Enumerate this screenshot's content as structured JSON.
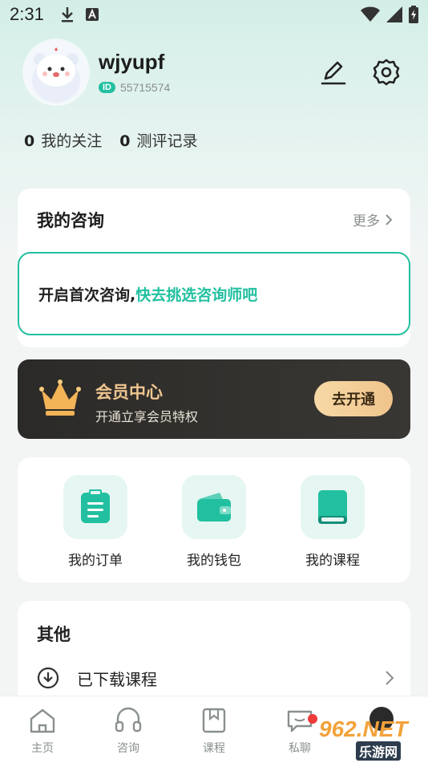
{
  "status_bar": {
    "time": "2:31"
  },
  "profile": {
    "username": "wjyupf",
    "id_badge": "ID",
    "user_id": "55715574"
  },
  "stats": [
    {
      "count": "0",
      "label": "我的关注"
    },
    {
      "count": "0",
      "label": "测评记录"
    }
  ],
  "consult": {
    "title": "我的咨询",
    "more": "更多",
    "prompt_plain": "开启首次咨询,",
    "prompt_link": "快去挑选咨询师吧"
  },
  "vip": {
    "title": "会员中心",
    "subtitle": "开通立享会员特权",
    "button": "去开通"
  },
  "quick_links": [
    {
      "label": "我的订单",
      "icon": "clipboard-icon"
    },
    {
      "label": "我的钱包",
      "icon": "wallet-icon"
    },
    {
      "label": "我的课程",
      "icon": "book-icon"
    }
  ],
  "other": {
    "title": "其他",
    "row_label": "已下载课程"
  },
  "tabs": [
    {
      "label": "主页",
      "icon": "home-icon"
    },
    {
      "label": "咨询",
      "icon": "headset-icon"
    },
    {
      "label": "课程",
      "icon": "bookmark-icon"
    },
    {
      "label": "私聊",
      "icon": "chat-icon"
    }
  ],
  "watermark": {
    "main": "962.NET",
    "sub": "乐游网"
  },
  "colors": {
    "accent": "#22c0a0",
    "vip_gold": "#f0c690",
    "vip_bg": "#2b2a28",
    "badge_red": "#ef3a3a"
  }
}
